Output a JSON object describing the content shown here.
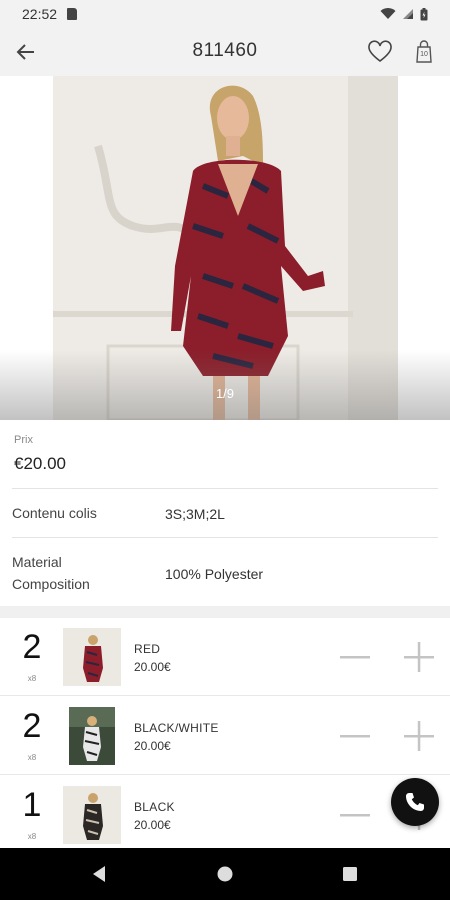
{
  "status_bar": {
    "time": "22:52"
  },
  "header": {
    "title": "811460",
    "bag_count": "10"
  },
  "gallery": {
    "pager": "1/9"
  },
  "product": {
    "price_label": "Prix",
    "price": "€20.00",
    "rows": [
      {
        "label": "Contenu colis",
        "value": "3S;3M;2L"
      },
      {
        "label_line1": "Material",
        "label_line2": "Composition",
        "value": "100% Polyester"
      }
    ]
  },
  "variants": [
    {
      "qty": "2",
      "qty_sub": "x8",
      "color": "RED",
      "price": "20.00€"
    },
    {
      "qty": "2",
      "qty_sub": "x8",
      "color": "BLACK/WHITE",
      "price": "20.00€"
    },
    {
      "qty": "1",
      "qty_sub": "x8",
      "color": "BLACK",
      "price": "20.00€"
    }
  ],
  "icons": {
    "back": "arrow-back-icon",
    "favorite": "heart-icon",
    "bag": "shopping-bag-icon",
    "minus": "minus-icon",
    "plus": "plus-icon",
    "call": "phone-icon"
  },
  "colors": {
    "fab": "#111111",
    "nav_bar": "#000000",
    "app_bar": "#f2f2f2"
  }
}
